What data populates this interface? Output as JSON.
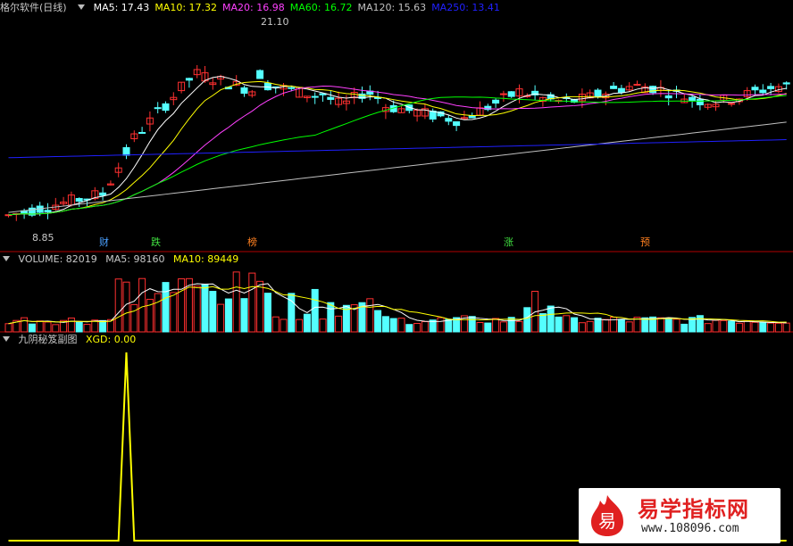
{
  "main_legend": {
    "title": "格尔软件(日线)",
    "ma": [
      {
        "label": "MA5: 17.43",
        "color": "#ffffff"
      },
      {
        "label": "MA10: 17.32",
        "color": "#ffff00"
      },
      {
        "label": "MA20: 16.98",
        "color": "#ff40ff"
      },
      {
        "label": "MA60: 16.72",
        "color": "#00ff00"
      },
      {
        "label": "MA120: 15.63",
        "color": "#c0c0c0"
      },
      {
        "label": "MA250: 13.41",
        "color": "#2020ff"
      }
    ]
  },
  "price_notes": {
    "high": "21.10",
    "low": "8.85"
  },
  "events": [
    {
      "label": "财",
      "color": "#4aa0ff"
    },
    {
      "label": "跌",
      "color": "#40e040"
    },
    {
      "label": "榜",
      "color": "#ff8020"
    },
    {
      "label": "涨",
      "color": "#40e040"
    },
    {
      "label": "预",
      "color": "#ff8020"
    }
  ],
  "volume_legend": {
    "title": "VOLUME: 82019",
    "ma5": "MA5: 98160",
    "ma10": "MA10: 89449",
    "colors": {
      "title": "#c8c8c8",
      "ma5": "#c8c8c8",
      "ma10": "#ffff00"
    }
  },
  "indicator_legend": {
    "title": "九阴秘笈副图",
    "value": "XGD: 0.00",
    "color": "#ffff00"
  },
  "watermark": {
    "title": "易学指标网",
    "url": "www.108096.com",
    "logo_char": "易"
  },
  "chart_data": {
    "type": "candlestick",
    "colors": {
      "up": "#ff3030",
      "down": "#54ffff",
      "ma5": "#ffffff",
      "ma10": "#ffff00",
      "ma20": "#ff40ff",
      "ma60": "#00ff00",
      "ma120": "#c0c0c0",
      "ma250": "#2020ff",
      "xgd": "#ffff00",
      "divider": "#b00000"
    },
    "price_range": [
      8.0,
      22.2
    ],
    "xgd_range": [
      0,
      1
    ],
    "xgd_pulse_index": 15
  }
}
